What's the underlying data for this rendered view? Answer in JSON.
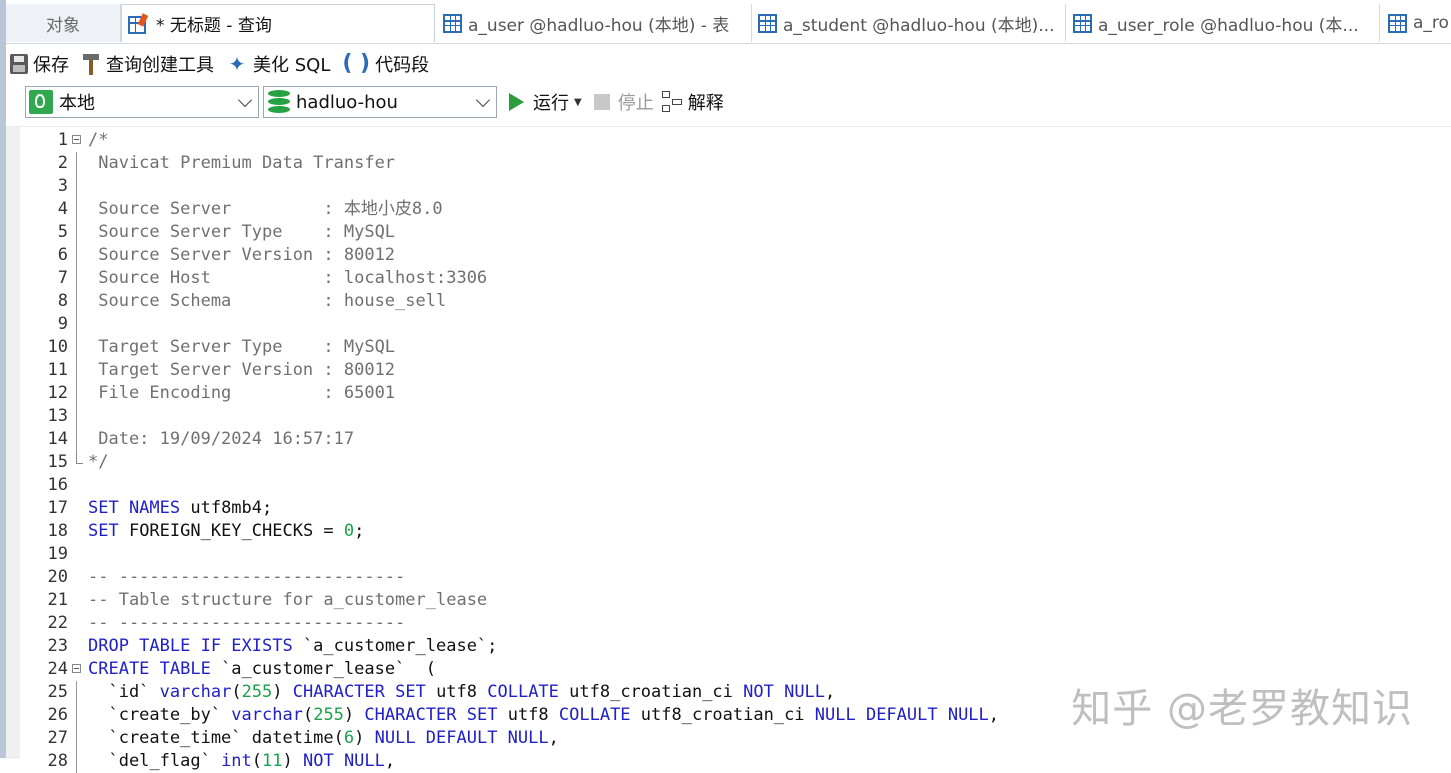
{
  "tabs": {
    "objects": "对象",
    "active_query": "* 无标题 - 查询",
    "user_table": "a_user @hadluo-hou (本地) - 表",
    "student_table": "a_student @hadluo-hou (本地)...",
    "user_role_table": "a_user_role @hadluo-hou (本...",
    "more_table": "a_ro"
  },
  "toolbar": {
    "save": "保存",
    "query_builder": "查询创建工具",
    "beautify_sql": "美化 SQL",
    "code_snippet": "代码段"
  },
  "connection_bar": {
    "connection": "本地",
    "database": "hadluo-hou",
    "run": "运行",
    "stop": "停止",
    "explain": "解释"
  },
  "editor": {
    "line_numbers": [
      "1",
      "2",
      "3",
      "4",
      "5",
      "6",
      "7",
      "8",
      "9",
      "10",
      "11",
      "12",
      "13",
      "14",
      "15",
      "16",
      "17",
      "18",
      "19",
      "20",
      "21",
      "22",
      "23",
      "24",
      "25",
      "26",
      "27",
      "28"
    ],
    "lines": {
      "l1": "/*",
      "l2": " Navicat Premium Data Transfer",
      "l4": " Source Server         : 本地小皮8.0",
      "l5": " Source Server Type    : MySQL",
      "l6": " Source Server Version : 80012",
      "l7": " Source Host           : localhost:3306",
      "l8": " Source Schema         : house_sell",
      "l10": " Target Server Type    : MySQL",
      "l11": " Target Server Version : 80012",
      "l12": " File Encoding         : 65001",
      "l14": " Date: 19/09/2024 16:57:17",
      "l15": "*/",
      "l17": [
        "SET NAMES",
        " utf8mb4;"
      ],
      "l18": [
        "SET",
        " FOREIGN_KEY_CHECKS = ",
        "0",
        ";"
      ],
      "l20": "-- ----------------------------",
      "l21": "-- Table structure for a_customer_lease",
      "l22": "-- ----------------------------",
      "l23": [
        "DROP TABLE IF EXISTS",
        " `a_customer_lease`;"
      ],
      "l24": [
        "CREATE TABLE",
        " `a_customer_lease`  ("
      ],
      "l25": [
        "  `id` ",
        "varchar",
        "(",
        "255",
        ") ",
        "CHARACTER SET",
        " utf8 ",
        "COLLATE",
        " utf8_croatian_ci ",
        "NOT NULL",
        ","
      ],
      "l26": [
        "  `create_by` ",
        "varchar",
        "(",
        "255",
        ") ",
        "CHARACTER SET",
        " utf8 ",
        "COLLATE",
        " utf8_croatian_ci ",
        "NULL DEFAULT NULL",
        ","
      ],
      "l27": [
        "  `create_time` datetime(",
        "6",
        ") ",
        "NULL DEFAULT NULL",
        ","
      ],
      "l28": [
        "  `del_flag` ",
        "int",
        "(",
        "11",
        ") ",
        "NOT NULL",
        ","
      ]
    }
  },
  "watermark": "知乎 @老罗教知识",
  "colors": {
    "keyword": "#2020c8",
    "number": "#1aa34a",
    "comment": "#707070",
    "run_green": "#2a9d3a",
    "db_green": "#25a244"
  }
}
